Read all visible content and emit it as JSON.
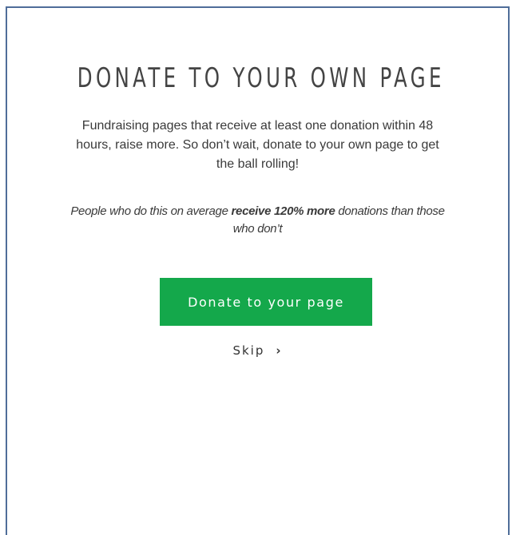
{
  "dialog": {
    "title": "DONATE TO YOUR OWN PAGE",
    "description": "Fundraising pages that receive at least one donation within 48 hours, raise more. So don’t wait, donate to your own page to get the ball rolling!",
    "stat": {
      "prefix": "People who do this on average ",
      "emphasis": "receive 120% more",
      "suffix": " donations than those who don’t"
    },
    "donate_button_label": "Donate to your page",
    "skip_label": "Skip",
    "skip_icon": "chevron-right-icon",
    "button_color": "#14a84b",
    "border_color": "#4f6d99"
  }
}
